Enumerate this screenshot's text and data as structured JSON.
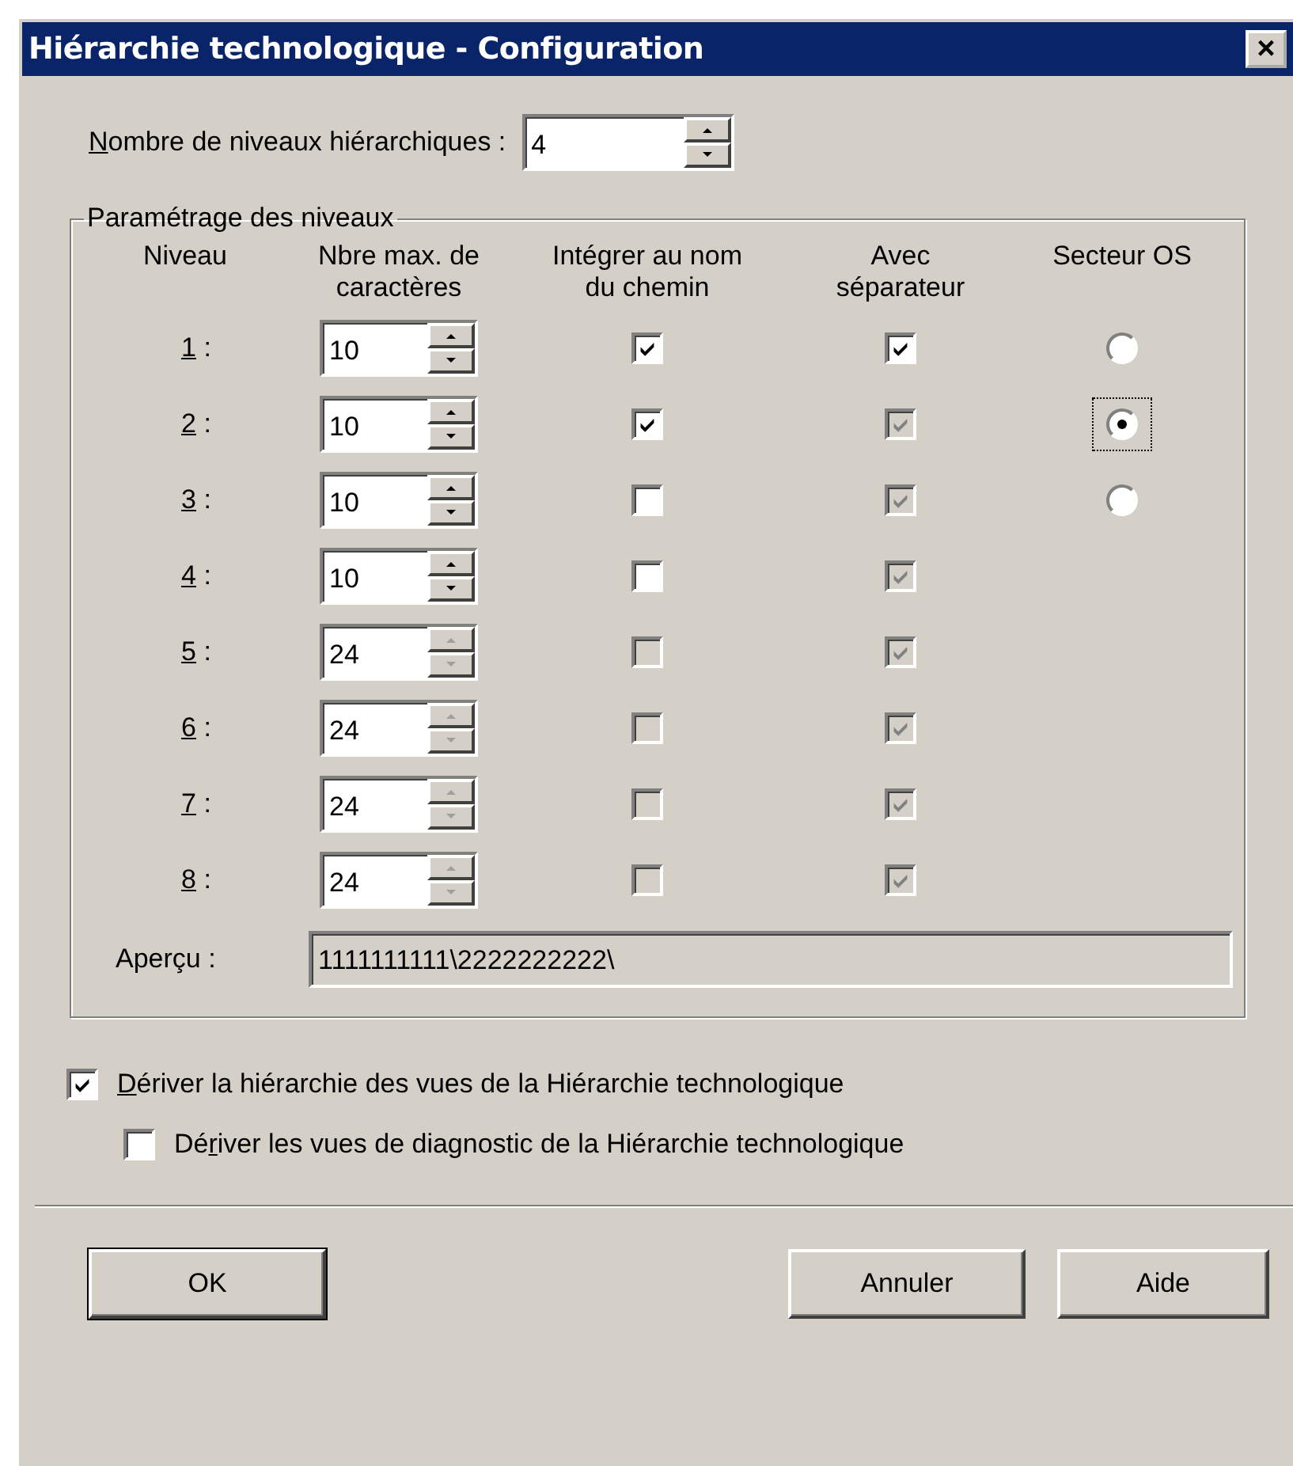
{
  "window": {
    "title": "Hiérarchie technologique - Configuration",
    "close": "×"
  },
  "level_count": {
    "label": {
      "key": "N",
      "after": "ombre de niveaux hiérarchiques :"
    },
    "value": "4"
  },
  "group": {
    "title": "Paramétrage des niveaux",
    "columns": [
      "Niveau",
      "Nbre max. de caractères",
      "Intégrer au nom du chemin",
      "Avec séparateur",
      "Secteur OS"
    ],
    "rows": [
      {
        "key": "1",
        "suffix": " :",
        "value": "10",
        "spin_disabled": false,
        "integrate": {
          "checked": true,
          "disabled": false
        },
        "separator": {
          "checked": true,
          "disabled": false
        },
        "sector": {
          "selected": false,
          "focused": false
        }
      },
      {
        "key": "2",
        "suffix": " :",
        "value": "10",
        "spin_disabled": false,
        "integrate": {
          "checked": true,
          "disabled": false
        },
        "separator": {
          "checked": true,
          "disabled": true
        },
        "sector": {
          "selected": true,
          "focused": true
        }
      },
      {
        "key": "3",
        "suffix": " :",
        "value": "10",
        "spin_disabled": false,
        "integrate": {
          "checked": false,
          "disabled": false
        },
        "separator": {
          "checked": true,
          "disabled": true
        },
        "sector": {
          "selected": false,
          "focused": false
        }
      },
      {
        "key": "4",
        "suffix": " :",
        "value": "10",
        "spin_disabled": false,
        "integrate": {
          "checked": false,
          "disabled": false
        },
        "separator": {
          "checked": true,
          "disabled": true
        }
      },
      {
        "key": "5",
        "suffix": " :",
        "value": "24",
        "spin_disabled": true,
        "integrate": {
          "checked": false,
          "disabled": true
        },
        "separator": {
          "checked": true,
          "disabled": true
        }
      },
      {
        "key": "6",
        "suffix": " :",
        "value": "24",
        "spin_disabled": true,
        "integrate": {
          "checked": false,
          "disabled": true
        },
        "separator": {
          "checked": true,
          "disabled": true
        }
      },
      {
        "key": "7",
        "suffix": " :",
        "value": "24",
        "spin_disabled": true,
        "integrate": {
          "checked": false,
          "disabled": true
        },
        "separator": {
          "checked": true,
          "disabled": true
        }
      },
      {
        "key": "8",
        "suffix": " :",
        "value": "24",
        "spin_disabled": true,
        "integrate": {
          "checked": false,
          "disabled": true
        },
        "separator": {
          "checked": true,
          "disabled": true
        }
      }
    ],
    "preview": {
      "label": "Aperçu :",
      "value": "1111111111\\2222222222\\"
    }
  },
  "options": [
    {
      "label": {
        "key": "D",
        "after": "ériver la hiérarchie des vues de la Hiérarchie technologique"
      },
      "checked": true,
      "children": [
        {
          "label": {
            "before": "Dé",
            "key": "r",
            "after": "iver les vues de diagnostic de la Hiérarchie technologique"
          },
          "checked": false
        }
      ]
    }
  ],
  "buttons": [
    "OK",
    "Annuler",
    "Aide"
  ]
}
